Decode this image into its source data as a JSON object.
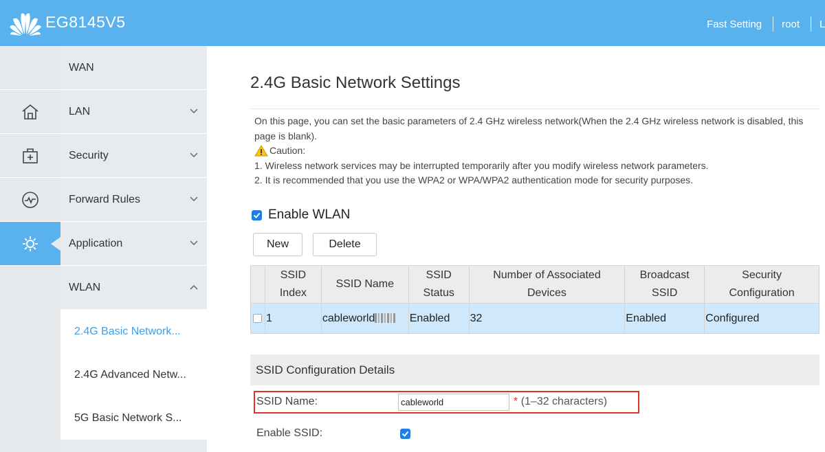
{
  "header": {
    "brand": "EG8145V5",
    "links": [
      "Fast Setting",
      "root",
      "L"
    ]
  },
  "rail": {
    "icons": [
      "home-icon",
      "toolbox-icon",
      "activity-icon",
      "gear-icon"
    ],
    "active_index": 3
  },
  "menu": {
    "items": [
      {
        "label": "WAN"
      },
      {
        "label": "LAN"
      },
      {
        "label": "Security"
      },
      {
        "label": "Forward Rules"
      },
      {
        "label": "Application"
      },
      {
        "label": "WLAN"
      }
    ],
    "submenu": [
      {
        "label": "2.4G Basic Network..."
      },
      {
        "label": "2.4G Advanced Netw..."
      },
      {
        "label": "5G Basic Network S..."
      }
    ]
  },
  "main": {
    "title": "2.4G Basic Network Settings",
    "intro": "On this page, you can set the basic parameters of 2.4 GHz wireless network(When the 2.4 GHz wireless network is disabled, this page is blank).",
    "caution_label": "Caution:",
    "caution_1": "1. Wireless network services may be interrupted temporarily after you modify wireless network parameters.",
    "caution_2": "2. It is recommended that you use the WPA2 or WPA/WPA2 authentication mode for security purposes.",
    "enable_wlan_label": "Enable WLAN",
    "new_label": "New",
    "delete_label": "Delete"
  },
  "table": {
    "headers": {
      "index_1": "SSID",
      "index_2": "Index",
      "name": "SSID Name",
      "status_1": "SSID",
      "status_2": "Status",
      "devices_1": "Number of Associated",
      "devices_2": "Devices",
      "broadcast_1": "Broadcast",
      "broadcast_2": "SSID",
      "security_1": "Security",
      "security_2": "Configuration"
    },
    "rows": [
      {
        "index": "1",
        "name": "cableworld",
        "status": "Enabled",
        "devices": "32",
        "broadcast": "Enabled",
        "security": "Configured"
      }
    ]
  },
  "details": {
    "title": "SSID Configuration Details",
    "ssid_name_label": "SSID Name:",
    "ssid_name_value": "cableworld",
    "ssid_name_hint": "(1–32 characters)",
    "required_mark": "*",
    "enable_ssid_label": "Enable SSID:"
  },
  "colors": {
    "header_bg": "#59b2ee",
    "accent": "#3ea0e8",
    "row_selected": "#cfe8fb",
    "highlight_border": "#e0342b"
  }
}
